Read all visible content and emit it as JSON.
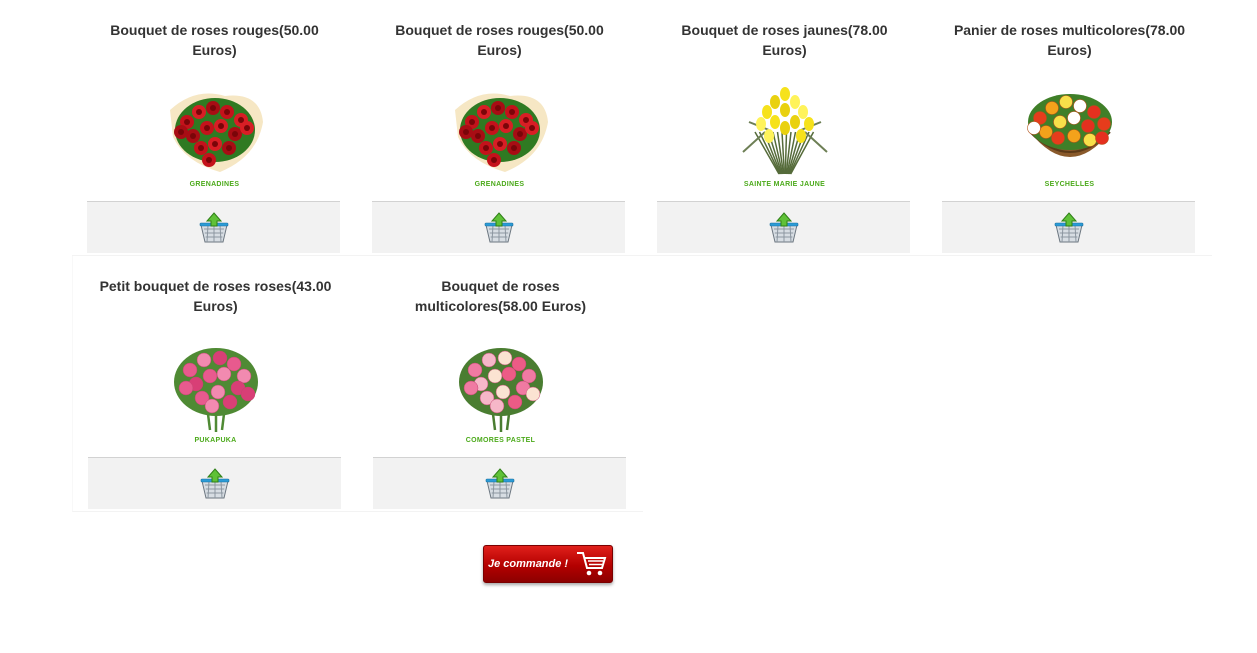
{
  "products": [
    {
      "title": "Bouquet de roses rouges(50.00 Euros)",
      "caption": "GRENADINES",
      "kind": "red"
    },
    {
      "title": "Bouquet de roses rouges(50.00 Euros)",
      "caption": "GRENADINES",
      "kind": "red"
    },
    {
      "title": "Bouquet de roses jaunes(78.00 Euros)",
      "caption": "SAINTE MARIE JAUNE",
      "kind": "yellow"
    },
    {
      "title": "Panier de roses multicolores(78.00 Euros)",
      "caption": "SEYCHELLES",
      "kind": "basket"
    },
    {
      "title": "Petit bouquet de roses roses(43.00 Euros)",
      "caption": "PUKAPUKA",
      "kind": "pink"
    },
    {
      "title": "Bouquet de roses multicolores(58.00 Euros)",
      "caption": "COMORES PASTEL",
      "kind": "pastel"
    }
  ],
  "cart_icon": "add-to-basket-icon",
  "order_button": {
    "label": "Je commande !",
    "icon": "shopping-cart-icon"
  },
  "colors": {
    "caption_green": "#4caa1b",
    "order_red": "#c00000",
    "bar_gray": "#f2f2f2"
  }
}
